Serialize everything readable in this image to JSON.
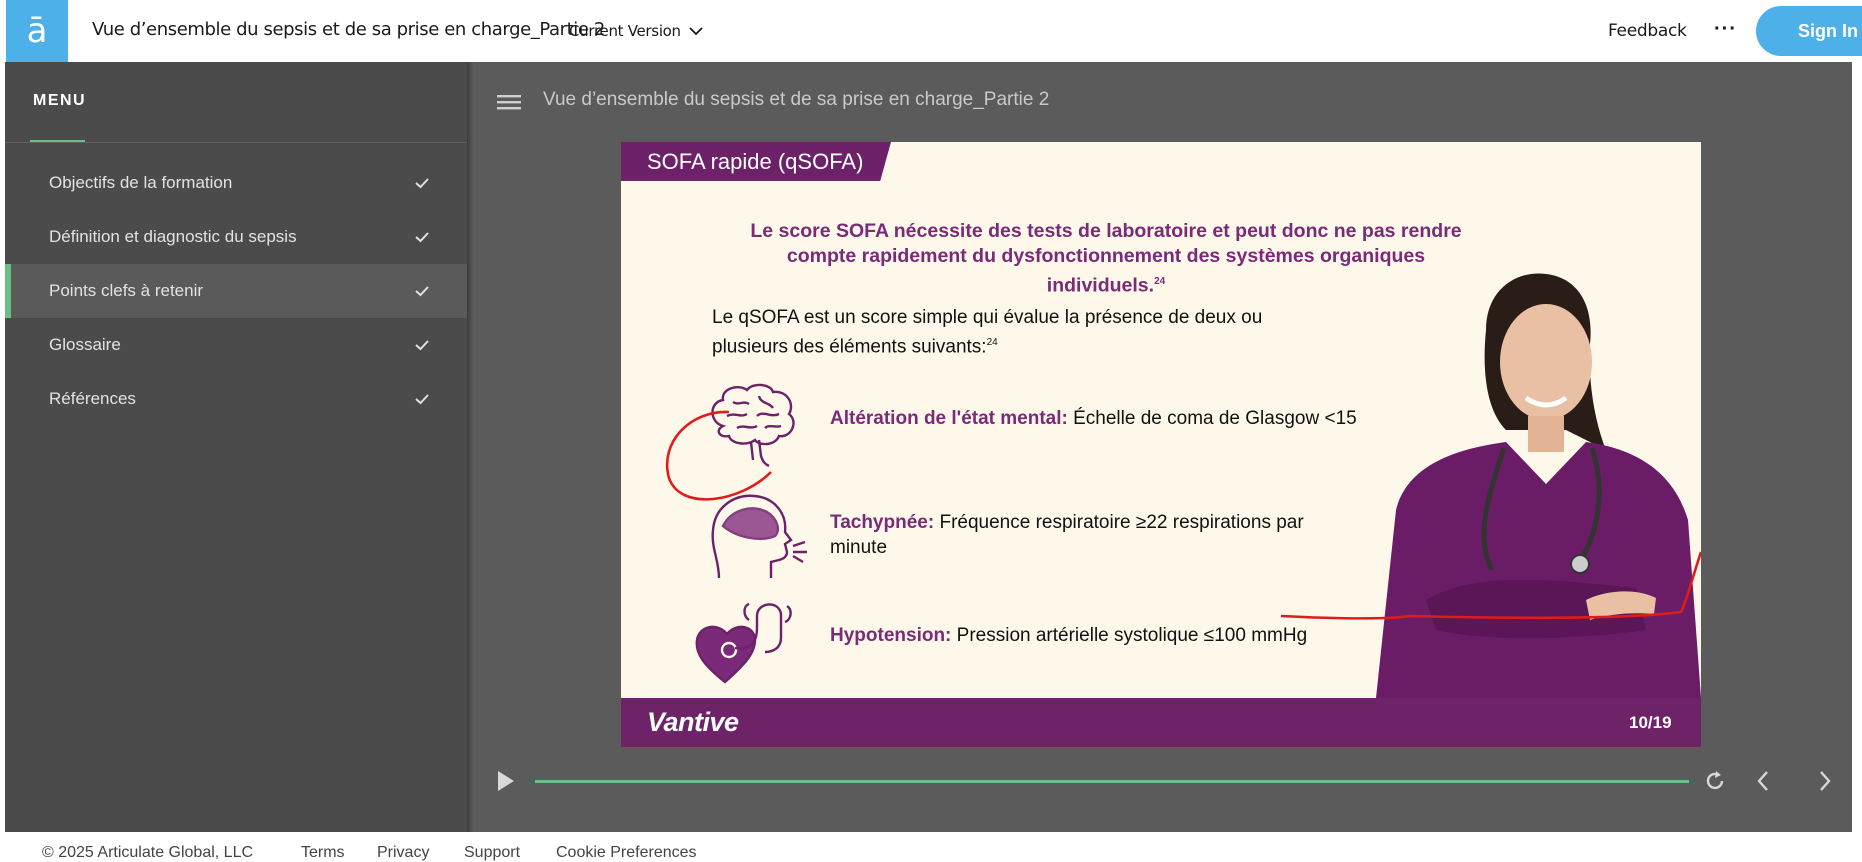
{
  "app": {
    "logo_glyph": "ā",
    "course_title": "Vue d’ensemble du sepsis et de sa prise en charge_Partie 2",
    "version_label": "Current Version",
    "feedback_label": "Feedback",
    "more_label": "···",
    "signin_label": "Sign In"
  },
  "sidebar": {
    "menu_label": "MENU",
    "items": [
      {
        "label": "Objectifs de la formation",
        "icon": "check-icon"
      },
      {
        "label": "Définition et diagnostic du sepsis",
        "icon": "check-icon"
      },
      {
        "label": "Points clefs à retenir",
        "icon": "check-icon",
        "active": true
      },
      {
        "label": "Glossaire",
        "icon": "check-icon"
      },
      {
        "label": "Références",
        "icon": "check-icon"
      }
    ]
  },
  "content": {
    "title": "Vue d’ensemble du sepsis et de sa prise en charge_Partie 2"
  },
  "slide": {
    "tag": "SOFA rapide (qSOFA)",
    "headline": "Le score SOFA nécessite des tests de laboratoire et peut donc ne pas rendre compte rapidement du dysfonctionnement des systèmes organiques individuels.",
    "headline_ref": "24",
    "intro": "Le qSOFA est un score simple qui évalue la présence de deux ou plusieurs des éléments suivants:",
    "intro_ref": "24",
    "criteria": [
      {
        "label": "Altération de l'état mental:",
        "text": " Échelle de coma de Glasgow <15",
        "icon": "brain-icon"
      },
      {
        "label": "Tachypnée:",
        "text": " Fréquence respiratoire ≥22 respirations par minute",
        "icon": "breathing-head-icon"
      },
      {
        "label": "Hypotension:",
        "text": " Pression artérielle systolique ≤100 mmHg",
        "icon": "heart-stethoscope-icon"
      }
    ],
    "brand": "Vantive",
    "page": "10/19"
  },
  "colors": {
    "accent": "#4db0e8",
    "purple": "#6d2169",
    "progress": "#6abf86",
    "annotation": "#e01b1b"
  },
  "player": {
    "progress": 1.0
  },
  "footer": {
    "copyright": "© 2025 Articulate Global, LLC",
    "links": [
      "Terms",
      "Privacy",
      "Support",
      "Cookie Preferences"
    ]
  }
}
